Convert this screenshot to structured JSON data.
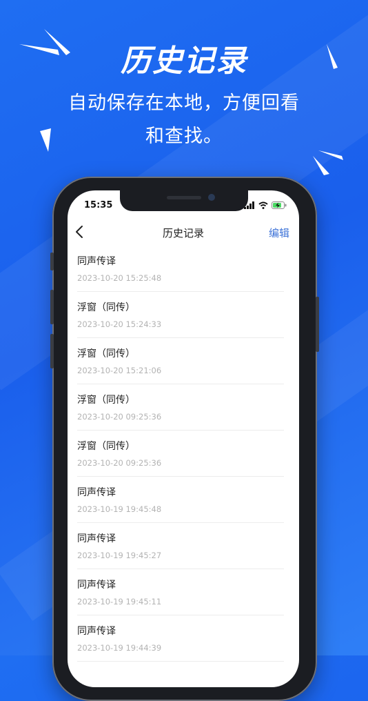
{
  "headline": "历史记录",
  "subtitle_line1": "自动保存在本地，方便回看",
  "subtitle_line2": "和查找。",
  "status_bar": {
    "time": "15:35"
  },
  "nav": {
    "title": "历史记录",
    "edit_label": "编辑",
    "back_icon": "chevron-left-icon"
  },
  "records": [
    {
      "title": "同声传译",
      "time": "2023-10-20 15:25:48"
    },
    {
      "title": "浮窗（同传）",
      "time": "2023-10-20 15:24:33"
    },
    {
      "title": "浮窗（同传）",
      "time": "2023-10-20 15:21:06"
    },
    {
      "title": "浮窗（同传）",
      "time": "2023-10-20 09:25:36"
    },
    {
      "title": "浮窗（同传）",
      "time": "2023-10-20 09:25:36"
    },
    {
      "title": "同声传译",
      "time": "2023-10-19 19:45:48"
    },
    {
      "title": "同声传译",
      "time": "2023-10-19 19:45:27"
    },
    {
      "title": "同声传译",
      "time": "2023-10-19 19:45:11"
    },
    {
      "title": "同声传译",
      "time": "2023-10-19 19:44:39"
    }
  ],
  "colors": {
    "background": "#1f6ef2",
    "accent": "#3f74d8"
  }
}
